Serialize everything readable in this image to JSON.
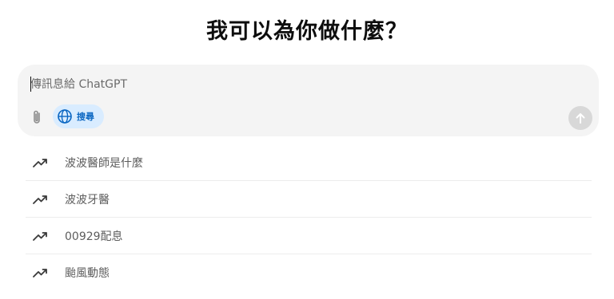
{
  "headline": "我可以為你做什麼？",
  "composer": {
    "placeholder": "傳訊息給 ChatGPT",
    "attach_icon": "paperclip-icon",
    "search_chip": {
      "icon": "globe-icon",
      "label": "搜尋"
    },
    "send_icon": "arrow-up-icon"
  },
  "suggestions": [
    {
      "icon": "trending-up-icon",
      "label": "波波醫師是什麼"
    },
    {
      "icon": "trending-up-icon",
      "label": "波波牙醫"
    },
    {
      "icon": "trending-up-icon",
      "label": "00929配息"
    },
    {
      "icon": "trending-up-icon",
      "label": "颱風動態"
    }
  ],
  "colors": {
    "composer_bg": "#f4f4f4",
    "chip_bg": "#d9ecff",
    "chip_text": "#0a66c2",
    "send_btn_disabled": "#d8d8d8",
    "suggestion_text": "#5d5d5d"
  }
}
